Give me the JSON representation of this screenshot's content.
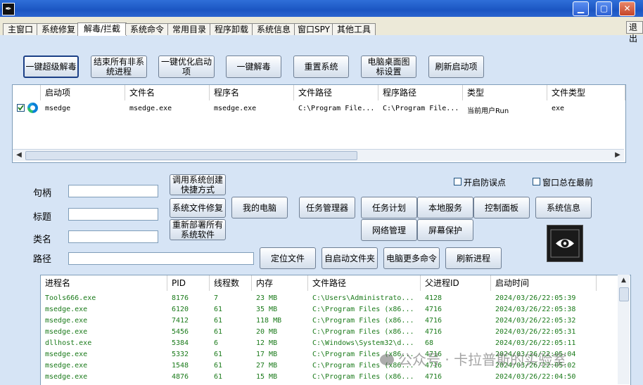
{
  "window": {
    "app_icon": "pen-icon",
    "minimize": "▁",
    "maximize": "▢",
    "close": "✕"
  },
  "tabs": [
    "主窗口",
    "系统修复",
    "解毒/拦截",
    "系统命令",
    "常用目录",
    "程序卸载",
    "系统信息",
    "窗口SPY",
    "其他工具"
  ],
  "exit_tab": "退出",
  "top_buttons": [
    "一键超级解毒",
    "结束所有非系统进程",
    "一键优化启动项",
    "一键解毒",
    "重置系统",
    "电脑桌面图标设置",
    "刷新启动项"
  ],
  "startup_grid": {
    "headers": [
      "启动项",
      "文件名",
      "程序名",
      "文件路径",
      "程序路径",
      "类型",
      "文件类型"
    ],
    "rows": [
      {
        "checked": true,
        "icon": "edge-icon",
        "cells": [
          "msedge",
          "msedge.exe",
          "msedge.exe",
          "C:\\Program File...",
          "C:\\Program File...",
          "当前用户Run",
          "exe"
        ]
      }
    ]
  },
  "spy": {
    "handle_label": "句柄",
    "title_label": "标题",
    "class_label": "类名",
    "path_label": "路径",
    "handle_value": "",
    "title_value": "",
    "class_value": "",
    "path_value": ""
  },
  "tool_buttons": {
    "create_shortcut": "调用系统创建快捷方式",
    "file_repair": "系统文件修复",
    "redeploy": "重新部署所有系统软件",
    "my_computer": "我的电脑",
    "task_manager": "任务管理器",
    "task_schedule": "任务计划",
    "local_services": "本地服务",
    "control_panel": "控制面板",
    "system_info": "系统信息",
    "network": "网络管理",
    "screensaver": "屏幕保护",
    "locate_file": "定位文件",
    "startup_folder": "自启动文件夹",
    "more_commands": "电脑更多命令",
    "refresh_process": "刷新进程"
  },
  "options": {
    "prevent_misclick": "开启防误点",
    "always_on_top": "窗口总在最前"
  },
  "process_grid": {
    "headers": [
      "进程名",
      "PID",
      "线程数",
      "内存",
      "文件路径",
      "父进程ID",
      "启动时间"
    ],
    "rows": [
      [
        "Tools666.exe",
        "8176",
        "7",
        "23 MB",
        "C:\\Users\\Administrato...",
        "4128",
        "2024/03/26/22:05:39"
      ],
      [
        "msedge.exe",
        "6120",
        "61",
        "35 MB",
        "C:\\Program Files (x86...",
        "4716",
        "2024/03/26/22:05:38"
      ],
      [
        "msedge.exe",
        "7412",
        "61",
        "118 MB",
        "C:\\Program Files (x86...",
        "4716",
        "2024/03/26/22:05:32"
      ],
      [
        "msedge.exe",
        "5456",
        "61",
        "20 MB",
        "C:\\Program Files (x86...",
        "4716",
        "2024/03/26/22:05:31"
      ],
      [
        "dllhost.exe",
        "5384",
        "6",
        "12 MB",
        "C:\\Windows\\System32\\d...",
        "68",
        "2024/03/26/22:05:11"
      ],
      [
        "msedge.exe",
        "5332",
        "61",
        "17 MB",
        "C:\\Program Files (x86...",
        "4716",
        "2024/03/26/22:05:04"
      ],
      [
        "msedge.exe",
        "1548",
        "61",
        "27 MB",
        "C:\\Program Files (x86...",
        "4716",
        "2024/03/26/22:05:02"
      ],
      [
        "msedge.exe",
        "4876",
        "61",
        "15 MB",
        "C:\\Program Files (x86...",
        "4716",
        "2024/03/26/22:04:50"
      ]
    ]
  },
  "watermark": "公众号 · 卡拉普斯的实验室",
  "colors": {
    "title_bar": "#1b55c2",
    "process_text": "#1a7a1a",
    "window_bg": "#d6e4f5"
  }
}
